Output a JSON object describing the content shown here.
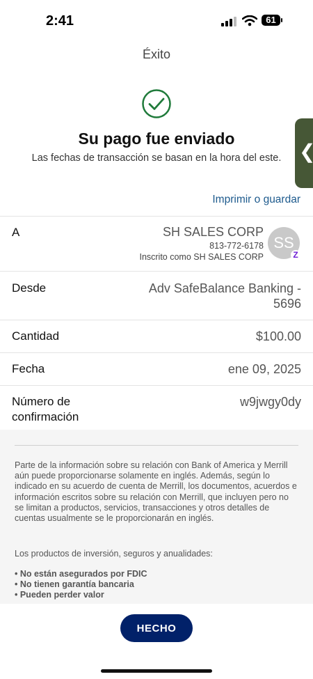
{
  "status_bar": {
    "time": "2:41",
    "battery": "61"
  },
  "nav": {
    "title": "Éxito"
  },
  "confirmation": {
    "icon": "check-circle-icon",
    "accent_color": "#1f7a3a",
    "headline": "Su pago fue enviado",
    "subtext": "Las fechas de transacción se basan en la hora del este."
  },
  "actions": {
    "print_label": "Imprimir o guardar",
    "done_label": "HECHO"
  },
  "side_tab": {
    "icon": "chevron-left-icon",
    "color": "#465736"
  },
  "details": {
    "to": {
      "label": "A",
      "name": "SH SALES CORP",
      "phone": "813-772-6178",
      "enrolled": "Inscrito como SH SALES CORP",
      "avatar_initials": "SS",
      "badge_glyph": "Z",
      "badge_icon": "zelle-icon"
    },
    "from": {
      "label": "Desde",
      "account_line1": "Adv SafeBalance Banking -",
      "account_line2": "5696"
    },
    "amount": {
      "label": "Cantidad",
      "value": "$100.00"
    },
    "date": {
      "label": "Fecha",
      "value": "ene 09, 2025"
    },
    "confirmation_number": {
      "label_line1": "Número de",
      "label_line2": "confirmación",
      "value": "w9jwgy0dy"
    }
  },
  "disclosure": {
    "paragraph": "Parte de la información sobre su relación con Bank of America y Merrill aún puede proporcionarse solamente en inglés. Además, según lo indicado en su acuerdo de cuenta de Merrill, los documentos, acuerdos e información escritos sobre su relación con Merrill, que incluyen pero no se limitan a productos, servicios, transacciones y otros detalles de cuentas usualmente se le proporcionarán en inglés.",
    "products_title": "Los productos de inversión, seguros y anualidades:",
    "bullets": [
      "• No están asegurados por FDIC",
      "• No tienen garantía bancaria",
      "• Pueden perder valor"
    ]
  },
  "colors": {
    "primary_button": "#012169",
    "link": "#1d5a8d"
  }
}
